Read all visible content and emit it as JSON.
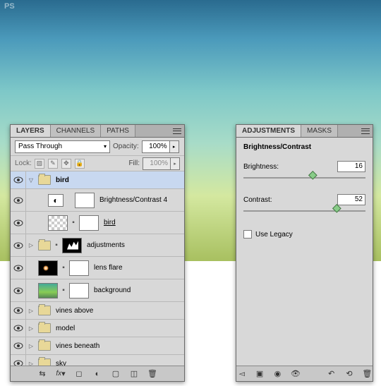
{
  "watermark": "PS",
  "layers_panel": {
    "tabs": [
      "LAYERS",
      "CHANNELS",
      "PATHS"
    ],
    "blend_mode": "Pass Through",
    "opacity_label": "Opacity:",
    "opacity_value": "100%",
    "lock_label": "Lock:",
    "fill_label": "Fill:",
    "fill_value": "100%",
    "layers": [
      {
        "name": "bird",
        "type": "group-open",
        "selected": true
      },
      {
        "name": "Brightness/Contrast 4",
        "type": "adj-bc"
      },
      {
        "name": "bird",
        "type": "bitmap-masked",
        "underlined": true
      },
      {
        "name": "adjustments",
        "type": "group-masked"
      },
      {
        "name": "lens flare",
        "type": "lensflare"
      },
      {
        "name": "background",
        "type": "bitmap-bg"
      },
      {
        "name": "vines above",
        "type": "group"
      },
      {
        "name": "model",
        "type": "group"
      },
      {
        "name": "vines beneath",
        "type": "group"
      },
      {
        "name": "sky",
        "type": "group"
      }
    ]
  },
  "adjustments_panel": {
    "tabs": [
      "ADJUSTMENTS",
      "MASKS"
    ],
    "title": "Brightness/Contrast",
    "brightness_label": "Brightness:",
    "brightness_value": "16",
    "contrast_label": "Contrast:",
    "contrast_value": "52",
    "use_legacy_label": "Use Legacy"
  }
}
